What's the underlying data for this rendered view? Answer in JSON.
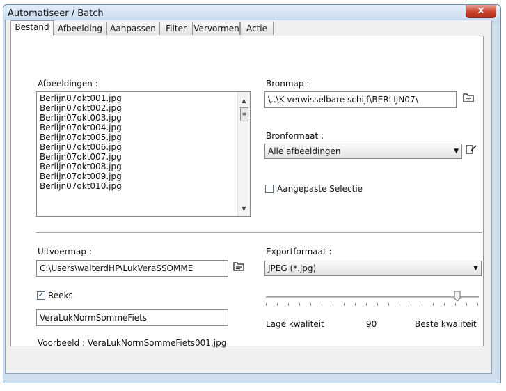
{
  "window": {
    "title": "Automatiseer / Batch",
    "close_symbol": "x"
  },
  "tabs": [
    {
      "label": "Bestand",
      "active": true
    },
    {
      "label": "Afbeelding",
      "active": false
    },
    {
      "label": "Aanpassen",
      "active": false
    },
    {
      "label": "Filter",
      "active": false
    },
    {
      "label": "Vervormen",
      "active": false
    },
    {
      "label": "Actie",
      "active": false
    }
  ],
  "images": {
    "label": "Afbeeldingen :",
    "items": [
      "Berlijn07okt001.jpg",
      "Berlijn07okt002.jpg",
      "Berlijn07okt003.jpg",
      "Berlijn07okt004.jpg",
      "Berlijn07okt005.jpg",
      "Berlijn07okt006.jpg",
      "Berlijn07okt007.jpg",
      "Berlijn07okt008.jpg",
      "Berlijn07okt009.jpg",
      "Berlijn07okt010.jpg"
    ]
  },
  "source_folder": {
    "label": "Bronmap :",
    "value": "\\..\\K verwisselbare schijf\\BERLIJN07\\",
    "browse_icon": "folder-browse-icon"
  },
  "source_format": {
    "label": "Bronformaat :",
    "selected": "Alle afbeeldingen",
    "edit_icon": "edit-icon"
  },
  "custom_selection": {
    "label": "Aangepaste Selectie",
    "checked": false
  },
  "output_folder": {
    "label": "Uitvoermap :",
    "value": "C:\\Users\\walterdHP\\LukVeraSSOMME",
    "browse_icon": "folder-browse-icon"
  },
  "series": {
    "label": "Reeks",
    "checked": true,
    "value": "VeraLukNormSommeFiets"
  },
  "preview": {
    "text": "Voorbeeld : VeraLukNormSommeFiets001.jpg"
  },
  "export_format": {
    "label": "Exportformaat :",
    "selected": "JPEG (*.jpg)"
  },
  "quality": {
    "low_label": "Lage kwaliteit",
    "value": "90",
    "high_label": "Beste kwaliteit",
    "level": 0.9
  },
  "colors": {
    "title_bar": "#c6d8ec",
    "close_button": "#c8432c",
    "dialog_bg": "#f0f0f0"
  }
}
